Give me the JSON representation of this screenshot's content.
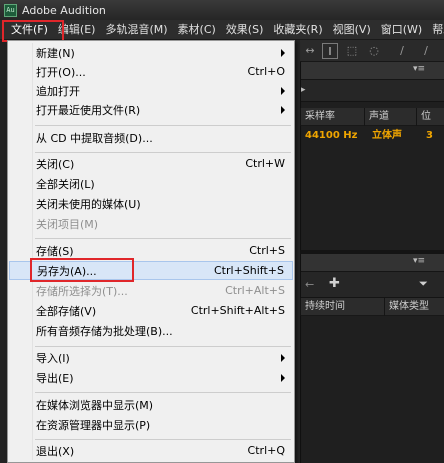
{
  "window": {
    "title": "Adobe Audition",
    "icon_text": "Au"
  },
  "menubar": {
    "items": [
      "文件(F)",
      "编辑(E)",
      "多轨混音(M)",
      "素材(C)",
      "效果(S)",
      "收藏夹(R)",
      "视图(V)",
      "窗口(W)",
      "帮助"
    ]
  },
  "file_menu": {
    "items": [
      {
        "label": "新建(N)",
        "shortcut": ""
      },
      {
        "label": "打开(O)...",
        "shortcut": "Ctrl+O"
      },
      {
        "label": "追加打开",
        "shortcut": ""
      },
      {
        "label": "打开最近使用文件(R)",
        "shortcut": ""
      },
      {
        "label": "从 CD 中提取音频(D)...",
        "shortcut": ""
      },
      {
        "label": "关闭(C)",
        "shortcut": "Ctrl+W"
      },
      {
        "label": "全部关闭(L)",
        "shortcut": ""
      },
      {
        "label": "关闭未使用的媒体(U)",
        "shortcut": ""
      },
      {
        "label": "关闭项目(M)",
        "shortcut": ""
      },
      {
        "label": "存储(S)",
        "shortcut": "Ctrl+S"
      },
      {
        "label": "另存为(A)...",
        "shortcut": "Ctrl+Shift+S"
      },
      {
        "label": "存储所选择为(T)...",
        "shortcut": "Ctrl+Alt+S"
      },
      {
        "label": "全部存储(V)",
        "shortcut": "Ctrl+Shift+Alt+S"
      },
      {
        "label": "所有音频存储为批处理(B)...",
        "shortcut": ""
      },
      {
        "label": "导入(I)",
        "shortcut": ""
      },
      {
        "label": "导出(E)",
        "shortcut": ""
      },
      {
        "label": "在媒体浏览器中显示(M)",
        "shortcut": ""
      },
      {
        "label": "在资源管理器中显示(P)",
        "shortcut": ""
      },
      {
        "label": "退出(X)",
        "shortcut": "Ctrl+Q"
      }
    ]
  },
  "files_panel": {
    "columns": [
      "采样率",
      "声道",
      "位"
    ],
    "row": {
      "sample_rate": "44100 Hz",
      "channels": "立体声",
      "bits": "3"
    }
  },
  "media_panel": {
    "columns": [
      "持续时间",
      "媒体类型"
    ]
  },
  "icons": {
    "panel_menu": "panel-menu-icon",
    "add": "add-icon",
    "filter": "filter-icon"
  }
}
